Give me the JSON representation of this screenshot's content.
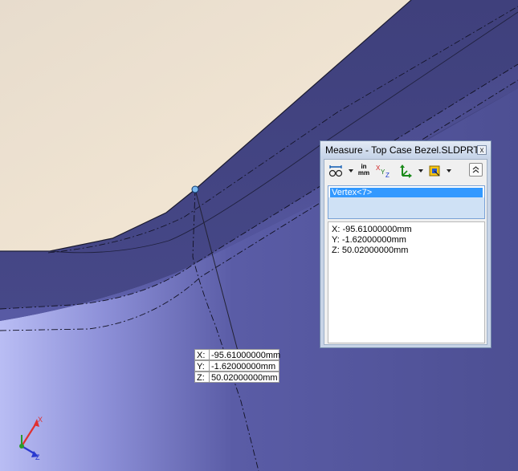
{
  "measure": {
    "title": "Measure - Top Case Bezel.SLDPRT",
    "close_glyph": "x",
    "toolbar": {
      "arc_circle_icon": "arc-circle-measure-icon",
      "units_top": "in",
      "units_bottom": "mm",
      "xyz_x": "X",
      "xyz_y": "Y",
      "xyz_z": "Z",
      "coordinate_system_icon": "coordinate-system-icon",
      "projection_icon": "projection-icon",
      "collapse_icon": "collapse-up-icon"
    },
    "selection": [
      "Vertex<7>"
    ],
    "results": {
      "x": "X: -95.61000000mm",
      "y": "Y: -1.62000000mm",
      "z": "Z: 50.02000000mm"
    }
  },
  "callout": {
    "x_label": "X:",
    "x_value": "-95.61000000mm",
    "y_label": "Y:",
    "y_value": "-1.62000000mm",
    "z_label": "Z:",
    "z_value": "50.02000000mm"
  },
  "triad": {
    "x_label": "X",
    "y_label": "Y",
    "z_label": "Z",
    "x_color": "#e03030",
    "y_color": "#2a9a2a",
    "z_color": "#2a3ad0"
  },
  "colors": {
    "face_top": "#efe3d2",
    "face_side": "#454684",
    "selection_highlight": "#3399ff"
  }
}
